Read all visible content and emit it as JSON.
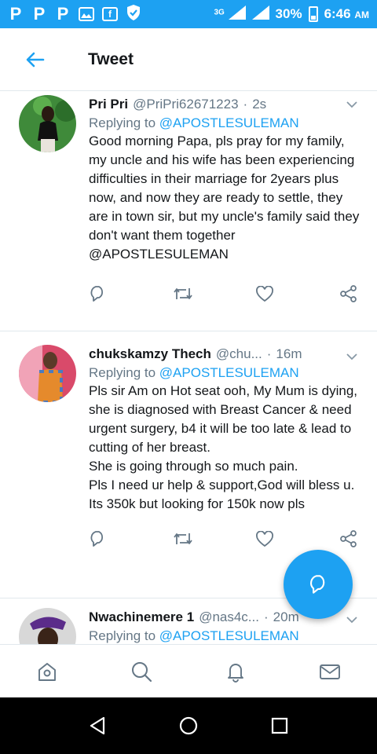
{
  "status_bar": {
    "network": "3G",
    "battery": "30%",
    "time": "6:46",
    "ampm": "AM"
  },
  "header": {
    "title": "Tweet"
  },
  "tweets": [
    {
      "name": "Pri Pri",
      "handle": "@PriPri62671223",
      "time": "2s",
      "replying_prefix": "Replying to ",
      "replying_to": "@APOSTLESULEMAN",
      "body": "Good morning Papa, pls pray for my family, my  uncle and his wife has been experiencing difficulties in their marriage for 2years plus now, and now they are ready to settle, they are in town sir, but my uncle's family said they don't want them together",
      "trailing_mention": "@APOSTLESULEMAN"
    },
    {
      "name": "chukskamzy Thech",
      "handle": "@chu...",
      "time": "16m",
      "replying_prefix": "Replying to ",
      "replying_to": "@APOSTLESULEMAN",
      "body": "Pls sir Am on Hot seat ooh, My Mum is dying, she is diagnosed with Breast Cancer & need urgent surgery, b4 it will be too late & lead to cutting of her breast.\nShe is going through so much pain.\nPls I need ur help & support,God will bless u.\nIts 350k but looking for 150k now pls"
    },
    {
      "name": "Nwachinemere 1",
      "handle": "@nas4c...",
      "time": "20m",
      "replying_prefix": "Replying to ",
      "replying_to": "@APOSTLESULEMAN"
    }
  ],
  "colors": {
    "accent": "#1da1f2",
    "secondary_text": "#657786",
    "divider": "#e1e8ed"
  },
  "icons": [
    "back-arrow-icon",
    "reply-icon",
    "retweet-icon",
    "like-icon",
    "share-icon",
    "chevron-down-icon",
    "compose-reply-icon",
    "home-icon",
    "search-icon",
    "notifications-icon",
    "messages-icon",
    "back-triangle-icon",
    "home-circle-icon",
    "recents-square-icon"
  ]
}
